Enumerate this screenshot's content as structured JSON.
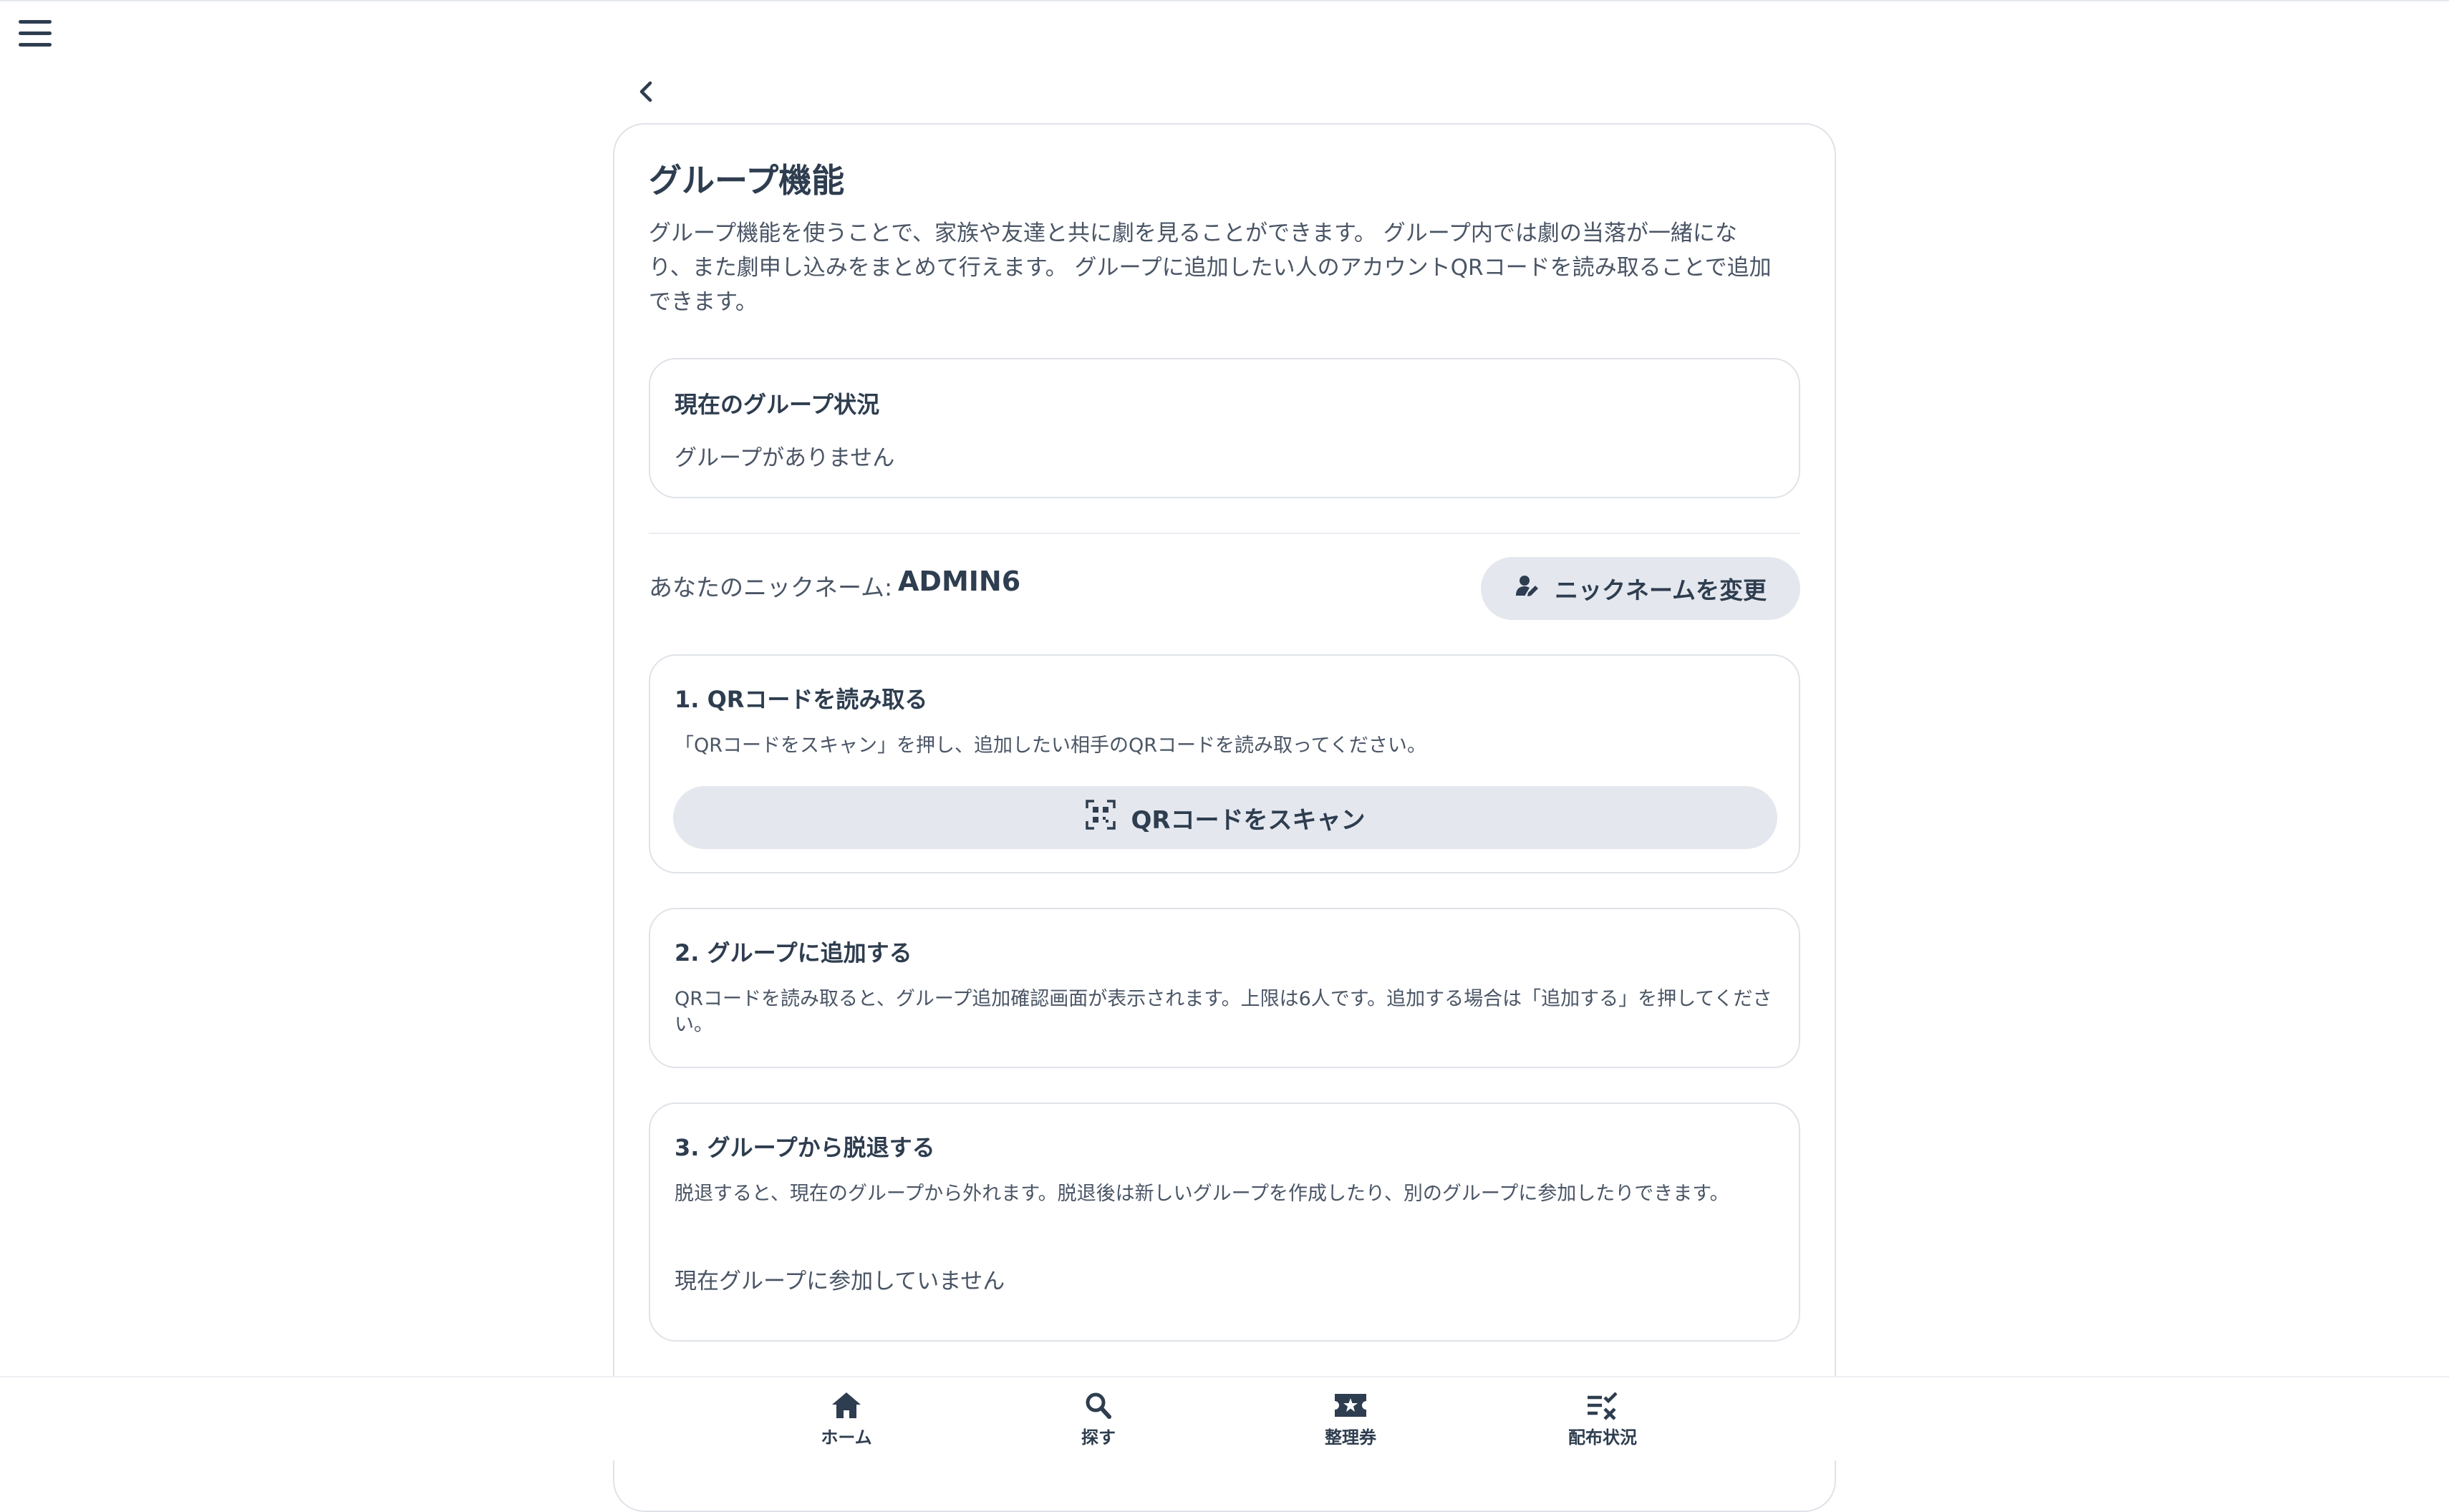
{
  "header": {
    "menu_icon": "hamburger-menu-icon",
    "back_icon": "chevron-left-icon"
  },
  "page": {
    "title": "グループ機能",
    "description": "グループ機能を使うことで、家族や友達と共に劇を見ることができます。 グループ内では劇の当落が一緒になり、また劇申し込みをまとめて行えます。 グループに追加したい人のアカウントQRコードを読み取ることで追加できます。"
  },
  "status": {
    "title": "現在のグループ状況",
    "text": "グループがありません"
  },
  "nickname": {
    "label": "あなたのニックネーム:",
    "value": "ADMIN6",
    "change_button": "ニックネームを変更"
  },
  "steps": [
    {
      "title": "1. QRコードを読み取る",
      "text": "「QRコードをスキャン」を押し、追加したい相手のQRコードを読み取ってください。",
      "button": "QRコードをスキャン"
    },
    {
      "title": "2. グループに追加する",
      "text": "QRコードを読み取ると、グループ追加確認画面が表示されます。上限は6人です。追加する場合は「追加する」を押してください。"
    },
    {
      "title": "3. グループから脱退する",
      "text": "脱退すると、現在のグループから外れます。脱退後は新しいグループを作成したり、別のグループに参加したりできます。",
      "status": "現在グループに参加していません"
    }
  ],
  "bottom_nav": [
    {
      "label": "ホーム",
      "icon": "home-icon"
    },
    {
      "label": "探す",
      "icon": "search-icon"
    },
    {
      "label": "整理券",
      "icon": "ticket-icon"
    },
    {
      "label": "配布状況",
      "icon": "checklist-icon"
    }
  ],
  "colors": {
    "text": "#2e3d4f",
    "muted": "#4a5565",
    "button_bg": "#e4e8ee",
    "border": "#dfe3e8"
  }
}
